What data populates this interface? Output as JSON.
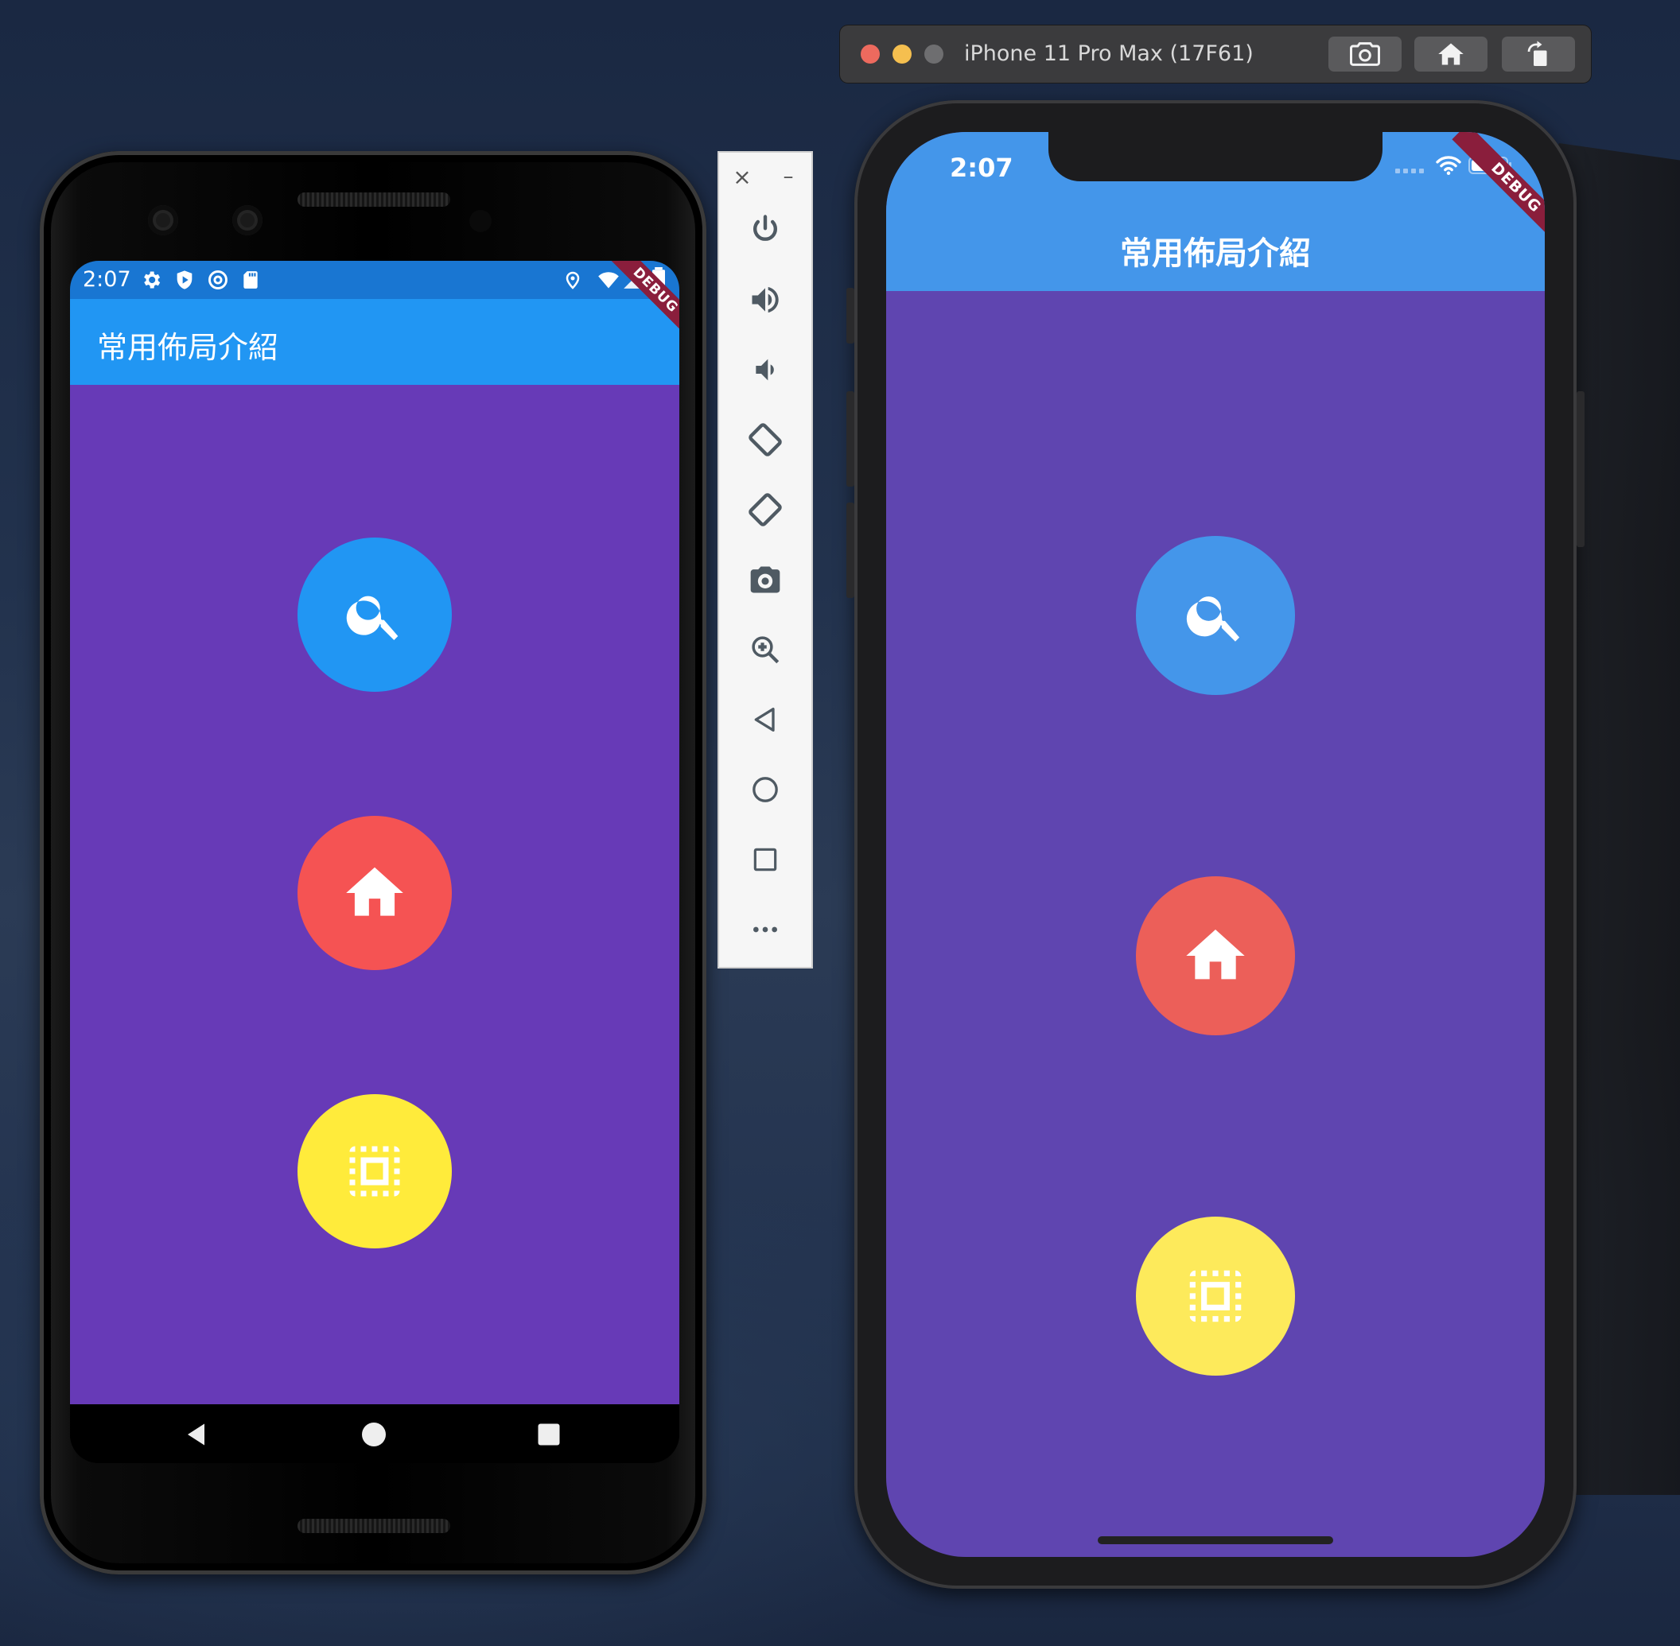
{
  "colors": {
    "android_statusbar": "#1976d2",
    "android_appbar": "#2196f3",
    "android_body": "#673ab7",
    "ios_header": "#4496ea",
    "ios_body": "#5f45b0",
    "search_blue": "#2196f3",
    "home_red": "#f55353",
    "yellow": "#ffeb3b",
    "debug_ribbon": "#8a1e3c"
  },
  "android": {
    "status_time": "2:07",
    "status_icons": [
      "gear-icon",
      "shield-play-icon",
      "at-icon",
      "sd-card-icon",
      "location-icon",
      "wifi-icon",
      "signal-icon",
      "battery-icon"
    ],
    "app_title": "常用佈局介紹",
    "debug_label": "DEBUG",
    "buttons": [
      {
        "icon": "search-icon",
        "color": "#2196f3"
      },
      {
        "icon": "home-icon",
        "color": "#f55353"
      },
      {
        "icon": "select-all-icon",
        "color": "#ffeb3b"
      }
    ],
    "nav": [
      "back-icon",
      "home-circle-icon",
      "recents-icon"
    ]
  },
  "emulator_toolbar": {
    "close_label": "×",
    "minimize_label": "–",
    "tools": [
      "power-icon",
      "volume-up-icon",
      "volume-down-icon",
      "rotate-left-icon",
      "rotate-right-icon",
      "camera-icon",
      "zoom-icon",
      "back-icon",
      "home-icon",
      "overview-icon",
      "more-icon"
    ]
  },
  "ios_simulator": {
    "window_title": "iPhone 11 Pro Max (17F61)",
    "toolbar_buttons": [
      "screenshot-icon",
      "home-icon",
      "rotate-icon"
    ],
    "status_time": "2:07",
    "app_title": "常用佈局介紹",
    "debug_label": "DEBUG",
    "buttons": [
      {
        "icon": "search-icon",
        "color": "#4496ea"
      },
      {
        "icon": "home-icon",
        "color": "#ec5f59"
      },
      {
        "icon": "select-all-icon",
        "color": "#fdea5b"
      }
    ]
  }
}
